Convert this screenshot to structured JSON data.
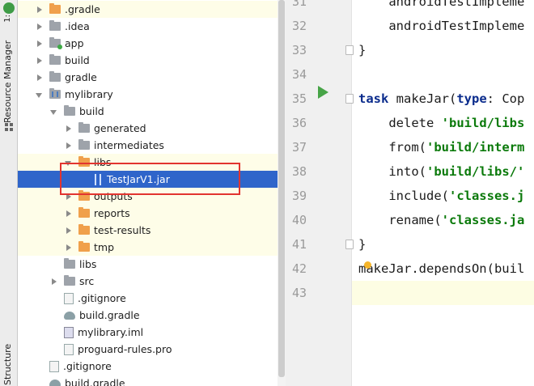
{
  "toolstrip": {
    "top_label": "1:",
    "resource_manager": "Resource Manager",
    "structure": "Structure"
  },
  "tree": {
    "rows": [
      {
        "label": ".gradle",
        "icon": "folder-orange",
        "arrow": "right",
        "indent": 0
      },
      {
        "label": ".idea",
        "icon": "folder-gray",
        "arrow": "right",
        "indent": 0
      },
      {
        "label": "app",
        "icon": "folder-app-module",
        "arrow": "right",
        "indent": 0
      },
      {
        "label": "build",
        "icon": "folder-gray",
        "arrow": "right",
        "indent": 0
      },
      {
        "label": "gradle",
        "icon": "folder-gray",
        "arrow": "right",
        "indent": 0
      },
      {
        "label": "mylibrary",
        "icon": "folder-library-module",
        "arrow": "down",
        "indent": 0
      },
      {
        "label": "build",
        "icon": "folder-gray",
        "arrow": "down",
        "indent": 1
      },
      {
        "label": "generated",
        "icon": "folder-gray",
        "arrow": "right",
        "indent": 2
      },
      {
        "label": "intermediates",
        "icon": "folder-gray",
        "arrow": "right",
        "indent": 2
      },
      {
        "label": "libs",
        "icon": "folder-orange",
        "arrow": "down",
        "indent": 2
      },
      {
        "label": "TestJarV1.jar",
        "icon": "jar-file",
        "arrow": "none",
        "indent": 3,
        "selected": true
      },
      {
        "label": "outputs",
        "icon": "folder-orange",
        "arrow": "right",
        "indent": 2
      },
      {
        "label": "reports",
        "icon": "folder-orange",
        "arrow": "right",
        "indent": 2
      },
      {
        "label": "test-results",
        "icon": "folder-orange",
        "arrow": "right",
        "indent": 2
      },
      {
        "label": "tmp",
        "icon": "folder-orange",
        "arrow": "right",
        "indent": 2
      },
      {
        "label": "libs",
        "icon": "folder-gray",
        "arrow": "none",
        "indent": 1
      },
      {
        "label": "src",
        "icon": "folder-gray",
        "arrow": "right",
        "indent": 1
      },
      {
        "label": ".gitignore",
        "icon": "text-file",
        "arrow": "none",
        "indent": 1
      },
      {
        "label": "build.gradle",
        "icon": "gradle-file",
        "arrow": "none",
        "indent": 1
      },
      {
        "label": "mylibrary.iml",
        "icon": "iml-file",
        "arrow": "none",
        "indent": 1
      },
      {
        "label": "proguard-rules.pro",
        "icon": "text-file",
        "arrow": "none",
        "indent": 1
      },
      {
        "label": ".gitignore",
        "icon": "text-file",
        "arrow": "none",
        "indent": 0
      },
      {
        "label": "build.gradle",
        "icon": "gradle-file",
        "arrow": "none",
        "indent": 0
      }
    ]
  },
  "editor": {
    "lines": [
      {
        "num": "31",
        "text": "    androidTestImpleme"
      },
      {
        "num": "32",
        "text": "    androidTestImpleme"
      },
      {
        "num": "33",
        "text": "}"
      },
      {
        "num": "34",
        "text": ""
      },
      {
        "num": "35",
        "kw1": "task",
        "mid": " makeJar(",
        "kw2": "type",
        "rest": ": Cop"
      },
      {
        "num": "36",
        "pre": "    delete ",
        "str": "'build/libs"
      },
      {
        "num": "37",
        "pre": "    from(",
        "str": "'build/interm"
      },
      {
        "num": "38",
        "pre": "    into(",
        "str": "'build/libs/'"
      },
      {
        "num": "39",
        "pre": "    include(",
        "str": "'classes.j"
      },
      {
        "num": "40",
        "pre": "    rename(",
        "str": "'classes.ja"
      },
      {
        "num": "41",
        "text": "}"
      },
      {
        "num": "42",
        "text": "makeJar.dependsOn(buil"
      },
      {
        "num": "43",
        "text": ""
      }
    ]
  },
  "colors": {
    "selection": "#2f65ca",
    "highlight_row": "#fefde8",
    "red_box": "#e2342f",
    "keyword": "#0a2b8c",
    "string": "#0b7a0b"
  }
}
